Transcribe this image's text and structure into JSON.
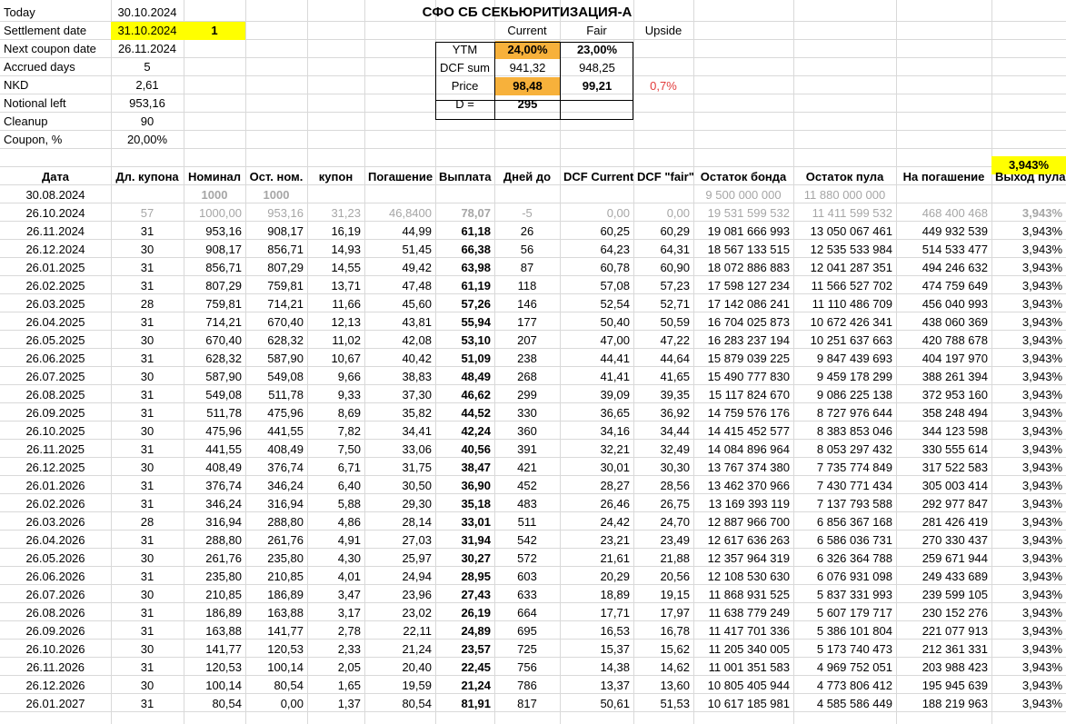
{
  "title": "СФО СБ СЕКЬЮРИТИЗАЦИЯ-А",
  "params": [
    {
      "label": "Today",
      "value": "30.10.2024"
    },
    {
      "label": "Settlement date",
      "value": "31.10.2024",
      "extra": "1"
    },
    {
      "label": "Next coupon date",
      "value": "26.11.2024"
    },
    {
      "label": "Accrued days",
      "value": "5"
    },
    {
      "label": "NKD",
      "value": "2,61"
    },
    {
      "label": "Notional left",
      "value": "953,16"
    },
    {
      "label": "Cleanup",
      "value": "90"
    },
    {
      "label": "Coupon, %",
      "value": "20,00%"
    }
  ],
  "summary": {
    "headers": [
      "Current",
      "Fair",
      "Upside"
    ],
    "rows": [
      {
        "label": "YTM",
        "current": "24,00%",
        "fair": "23,00%",
        "upside": ""
      },
      {
        "label": "DCF sum",
        "current": "941,32",
        "fair": "948,25",
        "upside": ""
      },
      {
        "label": "Price",
        "current": "98,48",
        "fair": "99,21",
        "upside": "0,7%"
      },
      {
        "label": "D =",
        "current": "295",
        "fair": "",
        "upside": ""
      }
    ]
  },
  "pool_exit_highlight": "3,943%",
  "table": {
    "columns": [
      "Дата",
      "Дл. купона",
      "Номинал",
      "Ост. ном.",
      "купон",
      "Погашение",
      "Выплата",
      "Дней до",
      "DCF Current",
      "DCF \"fair\"",
      "Остаток бонда",
      "Остаток пула",
      "На погашение",
      "Выход пула"
    ],
    "rows": [
      [
        "30.08.2024",
        "",
        "1000",
        "1000",
        "",
        "",
        "",
        "",
        "",
        "",
        "9 500 000 000",
        "11 880 000 000",
        "",
        ""
      ],
      [
        "26.10.2024",
        "57",
        "1000,00",
        "953,16",
        "31,23",
        "46,8400",
        "78,07",
        "-5",
        "0,00",
        "0,00",
        "19 531 599 532",
        "11 411 599 532",
        "468 400 468",
        "3,943%"
      ],
      [
        "26.11.2024",
        "31",
        "953,16",
        "908,17",
        "16,19",
        "44,99",
        "61,18",
        "26",
        "60,25",
        "60,29",
        "19 081 666 993",
        "13 050 067 461",
        "449 932 539",
        "3,943%"
      ],
      [
        "26.12.2024",
        "30",
        "908,17",
        "856,71",
        "14,93",
        "51,45",
        "66,38",
        "56",
        "64,23",
        "64,31",
        "18 567 133 515",
        "12 535 533 984",
        "514 533 477",
        "3,943%"
      ],
      [
        "26.01.2025",
        "31",
        "856,71",
        "807,29",
        "14,55",
        "49,42",
        "63,98",
        "87",
        "60,78",
        "60,90",
        "18 072 886 883",
        "12 041 287 351",
        "494 246 632",
        "3,943%"
      ],
      [
        "26.02.2025",
        "31",
        "807,29",
        "759,81",
        "13,71",
        "47,48",
        "61,19",
        "118",
        "57,08",
        "57,23",
        "17 598 127 234",
        "11 566 527 702",
        "474 759 649",
        "3,943%"
      ],
      [
        "26.03.2025",
        "28",
        "759,81",
        "714,21",
        "11,66",
        "45,60",
        "57,26",
        "146",
        "52,54",
        "52,71",
        "17 142 086 241",
        "11 110 486 709",
        "456 040 993",
        "3,943%"
      ],
      [
        "26.04.2025",
        "31",
        "714,21",
        "670,40",
        "12,13",
        "43,81",
        "55,94",
        "177",
        "50,40",
        "50,59",
        "16 704 025 873",
        "10 672 426 341",
        "438 060 369",
        "3,943%"
      ],
      [
        "26.05.2025",
        "30",
        "670,40",
        "628,32",
        "11,02",
        "42,08",
        "53,10",
        "207",
        "47,00",
        "47,22",
        "16 283 237 194",
        "10 251 637 663",
        "420 788 678",
        "3,943%"
      ],
      [
        "26.06.2025",
        "31",
        "628,32",
        "587,90",
        "10,67",
        "40,42",
        "51,09",
        "238",
        "44,41",
        "44,64",
        "15 879 039 225",
        "9 847 439 693",
        "404 197 970",
        "3,943%"
      ],
      [
        "26.07.2025",
        "30",
        "587,90",
        "549,08",
        "9,66",
        "38,83",
        "48,49",
        "268",
        "41,41",
        "41,65",
        "15 490 777 830",
        "9 459 178 299",
        "388 261 394",
        "3,943%"
      ],
      [
        "26.08.2025",
        "31",
        "549,08",
        "511,78",
        "9,33",
        "37,30",
        "46,62",
        "299",
        "39,09",
        "39,35",
        "15 117 824 670",
        "9 086 225 138",
        "372 953 160",
        "3,943%"
      ],
      [
        "26.09.2025",
        "31",
        "511,78",
        "475,96",
        "8,69",
        "35,82",
        "44,52",
        "330",
        "36,65",
        "36,92",
        "14 759 576 176",
        "8 727 976 644",
        "358 248 494",
        "3,943%"
      ],
      [
        "26.10.2025",
        "30",
        "475,96",
        "441,55",
        "7,82",
        "34,41",
        "42,24",
        "360",
        "34,16",
        "34,44",
        "14 415 452 577",
        "8 383 853 046",
        "344 123 598",
        "3,943%"
      ],
      [
        "26.11.2025",
        "31",
        "441,55",
        "408,49",
        "7,50",
        "33,06",
        "40,56",
        "391",
        "32,21",
        "32,49",
        "14 084 896 964",
        "8 053 297 432",
        "330 555 614",
        "3,943%"
      ],
      [
        "26.12.2025",
        "30",
        "408,49",
        "376,74",
        "6,71",
        "31,75",
        "38,47",
        "421",
        "30,01",
        "30,30",
        "13 767 374 380",
        "7 735 774 849",
        "317 522 583",
        "3,943%"
      ],
      [
        "26.01.2026",
        "31",
        "376,74",
        "346,24",
        "6,40",
        "30,50",
        "36,90",
        "452",
        "28,27",
        "28,56",
        "13 462 370 966",
        "7 430 771 434",
        "305 003 414",
        "3,943%"
      ],
      [
        "26.02.2026",
        "31",
        "346,24",
        "316,94",
        "5,88",
        "29,30",
        "35,18",
        "483",
        "26,46",
        "26,75",
        "13 169 393 119",
        "7 137 793 588",
        "292 977 847",
        "3,943%"
      ],
      [
        "26.03.2026",
        "28",
        "316,94",
        "288,80",
        "4,86",
        "28,14",
        "33,01",
        "511",
        "24,42",
        "24,70",
        "12 887 966 700",
        "6 856 367 168",
        "281 426 419",
        "3,943%"
      ],
      [
        "26.04.2026",
        "31",
        "288,80",
        "261,76",
        "4,91",
        "27,03",
        "31,94",
        "542",
        "23,21",
        "23,49",
        "12 617 636 263",
        "6 586 036 731",
        "270 330 437",
        "3,943%"
      ],
      [
        "26.05.2026",
        "30",
        "261,76",
        "235,80",
        "4,30",
        "25,97",
        "30,27",
        "572",
        "21,61",
        "21,88",
        "12 357 964 319",
        "6 326 364 788",
        "259 671 944",
        "3,943%"
      ],
      [
        "26.06.2026",
        "31",
        "235,80",
        "210,85",
        "4,01",
        "24,94",
        "28,95",
        "603",
        "20,29",
        "20,56",
        "12 108 530 630",
        "6 076 931 098",
        "249 433 689",
        "3,943%"
      ],
      [
        "26.07.2026",
        "30",
        "210,85",
        "186,89",
        "3,47",
        "23,96",
        "27,43",
        "633",
        "18,89",
        "19,15",
        "11 868 931 525",
        "5 837 331 993",
        "239 599 105",
        "3,943%"
      ],
      [
        "26.08.2026",
        "31",
        "186,89",
        "163,88",
        "3,17",
        "23,02",
        "26,19",
        "664",
        "17,71",
        "17,97",
        "11 638 779 249",
        "5 607 179 717",
        "230 152 276",
        "3,943%"
      ],
      [
        "26.09.2026",
        "31",
        "163,88",
        "141,77",
        "2,78",
        "22,11",
        "24,89",
        "695",
        "16,53",
        "16,78",
        "11 417 701 336",
        "5 386 101 804",
        "221 077 913",
        "3,943%"
      ],
      [
        "26.10.2026",
        "30",
        "141,77",
        "120,53",
        "2,33",
        "21,24",
        "23,57",
        "725",
        "15,37",
        "15,62",
        "11 205 340 005",
        "5 173 740 473",
        "212 361 331",
        "3,943%"
      ],
      [
        "26.11.2026",
        "31",
        "120,53",
        "100,14",
        "2,05",
        "20,40",
        "22,45",
        "756",
        "14,38",
        "14,62",
        "11 001 351 583",
        "4 969 752 051",
        "203 988 423",
        "3,943%"
      ],
      [
        "26.12.2026",
        "30",
        "100,14",
        "80,54",
        "1,65",
        "19,59",
        "21,24",
        "786",
        "13,37",
        "13,60",
        "10 805 405 944",
        "4 773 806 412",
        "195 945 639",
        "3,943%"
      ],
      [
        "26.01.2027",
        "31",
        "80,54",
        "0,00",
        "1,37",
        "80,54",
        "81,91",
        "817",
        "50,61",
        "51,53",
        "10 617 185 981",
        "4 585 586 449",
        "188 219 963",
        "3,943%"
      ]
    ]
  }
}
